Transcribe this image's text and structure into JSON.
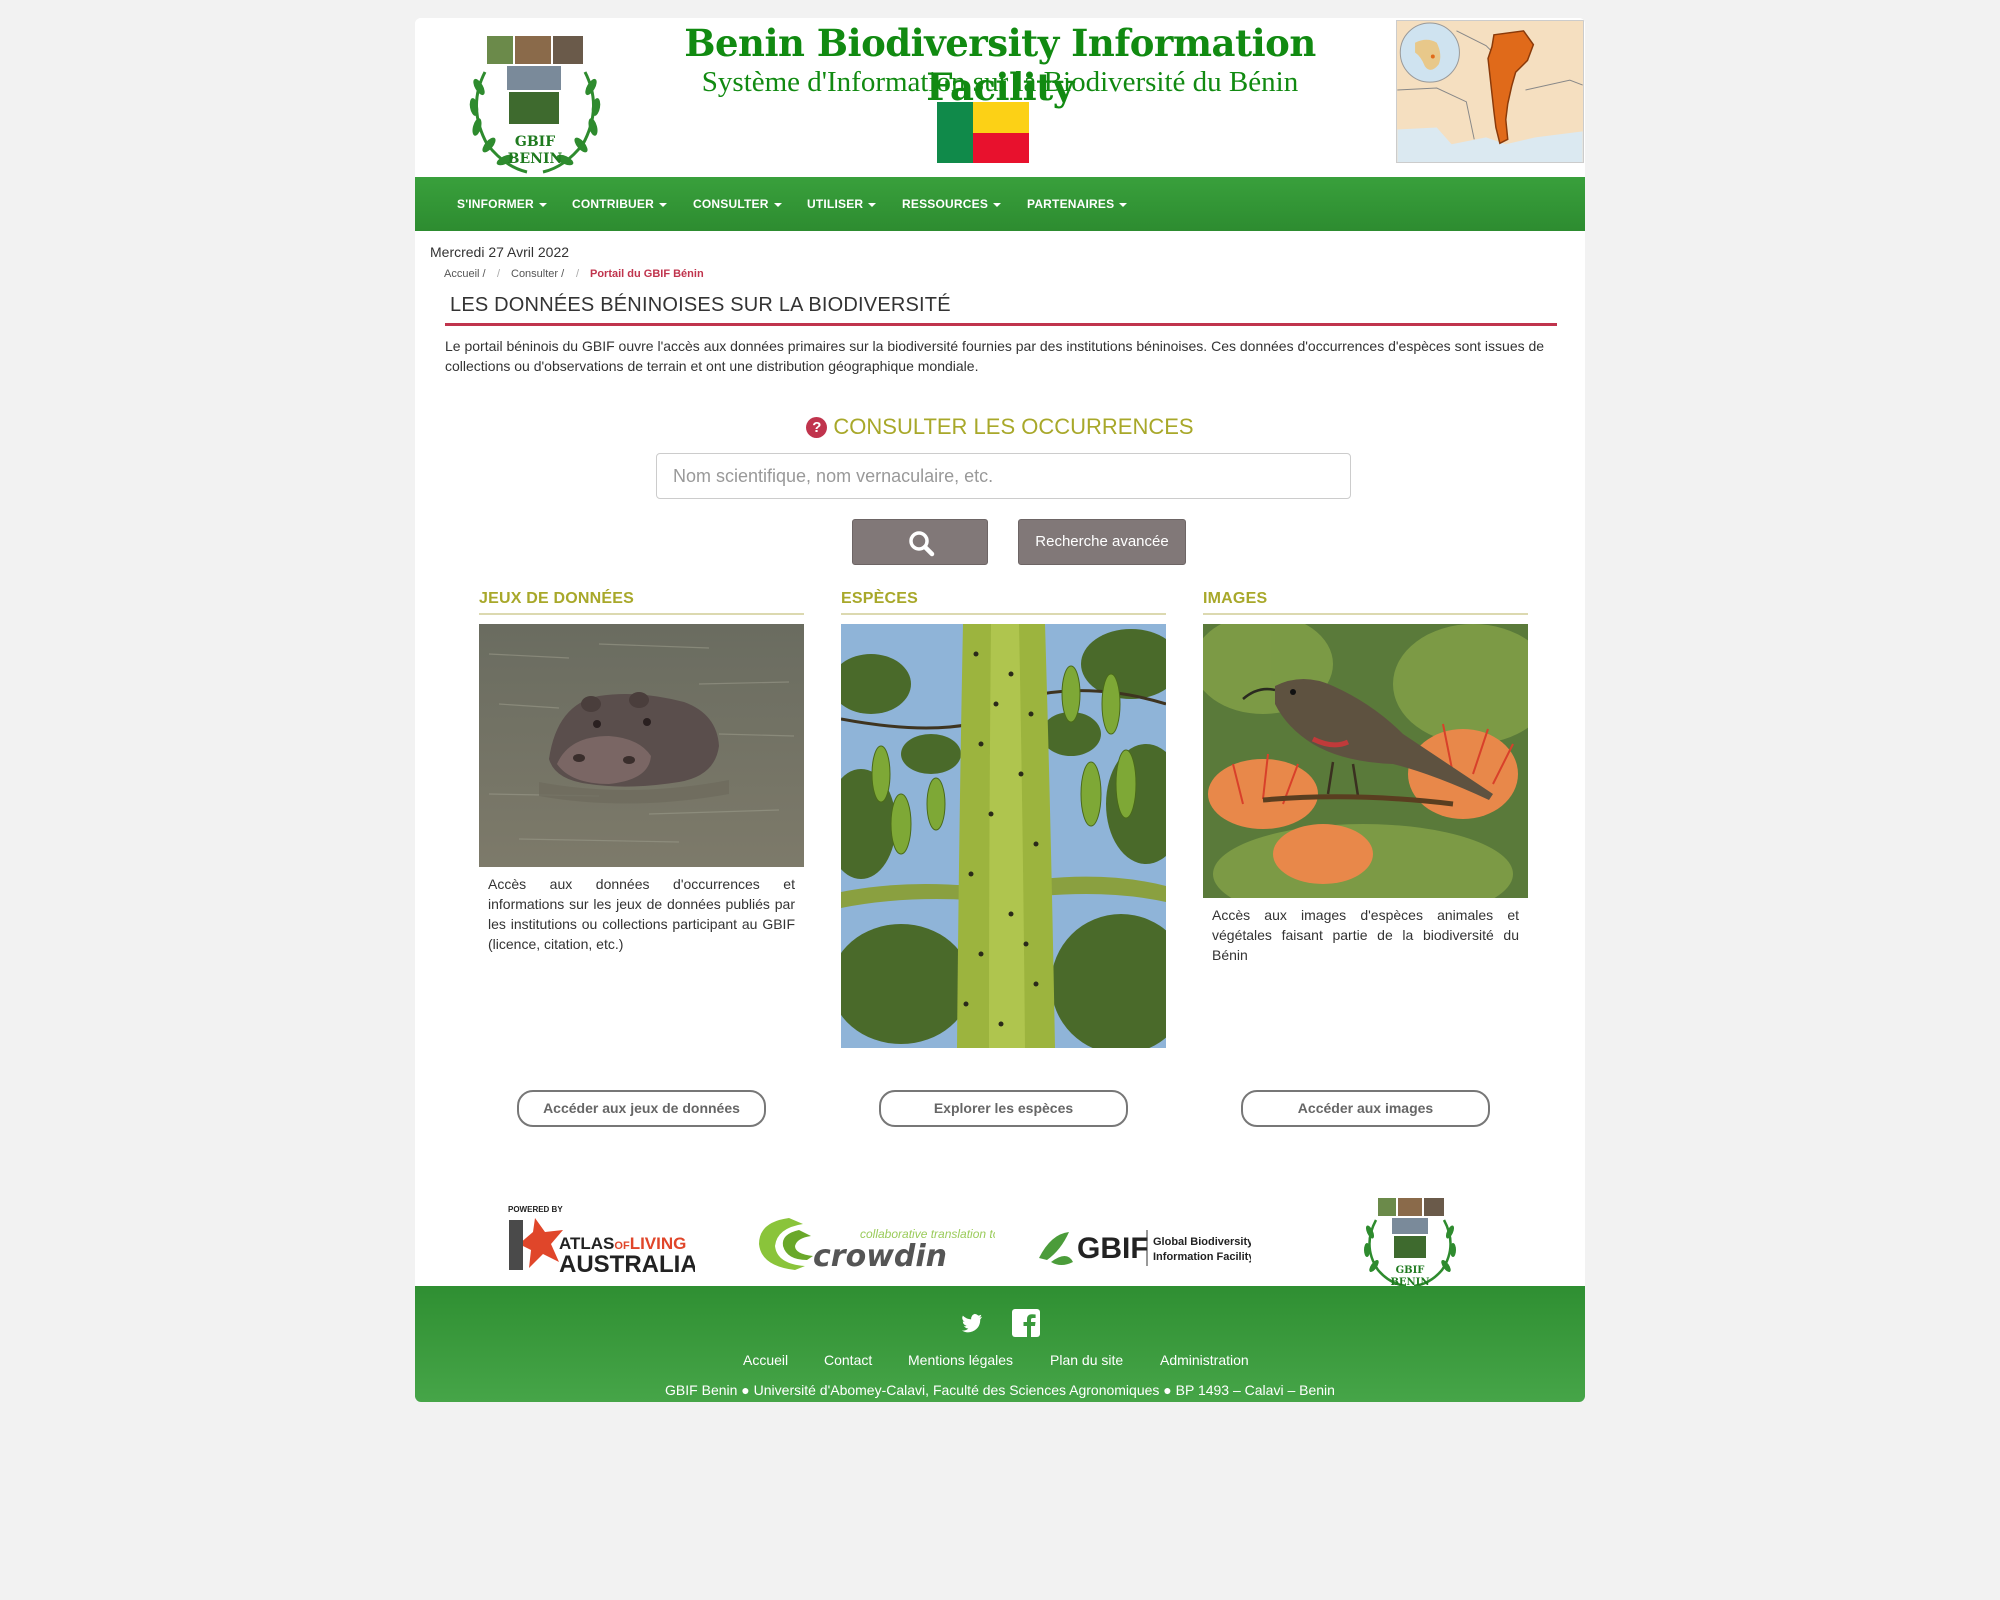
{
  "header": {
    "title": "Benin Biodiversity Information Facility",
    "subtitle": "Système d'Information sur la Biodiversité du Bénin",
    "logo_text_1": "GBIF",
    "logo_text_2": "BENIN"
  },
  "nav": {
    "items": [
      {
        "label": "S'INFORMER"
      },
      {
        "label": "CONTRIBUER"
      },
      {
        "label": "CONSULTER"
      },
      {
        "label": "UTILISER"
      },
      {
        "label": "RESSOURCES"
      },
      {
        "label": "PARTENAIRES"
      }
    ]
  },
  "date": "Mercredi 27 Avril 2022",
  "breadcrumb": {
    "items": [
      "Accueil /",
      "Consulter /",
      "Portail du GBIF Bénin"
    ],
    "separator": "/"
  },
  "section": {
    "title": "LES DONNÉES BÉNINOISES SUR LA BIODIVERSITÉ",
    "intro": "Le portail béninois du GBIF ouvre l'accès aux données primaires sur la biodiversité fournies par des institutions béninoises. Ces données d'occurrences d'espèces sont issues de collections ou d'observations de terrain et ont une distribution géographique mondiale."
  },
  "occurrences": {
    "heading": "CONSULTER LES OCCURRENCES",
    "help_icon": "?",
    "search_placeholder": "Nom scientifique, nom vernaculaire, etc.",
    "search_icon": "magnifier-icon",
    "advanced_label": "Recherche avancée"
  },
  "columns": [
    {
      "heading": "JEUX DE DONNÉES",
      "image": "hippopotamus-in-water",
      "text": "Accès aux données d'occurrences et informations sur les jeux de données publiés par les institutions ou collections participant au GBIF (licence, citation, etc.)",
      "button": "Accéder aux jeux de données"
    },
    {
      "heading": "ESPÈCES",
      "image": "spiny-tree-trunk-with-fruits",
      "text": "",
      "button": "Explorer les espèces"
    },
    {
      "heading": "IMAGES",
      "image": "sunbird-on-flowers",
      "text": "Accès aux images d'espèces animales et végétales faisant partie de la biodiversité du Bénin",
      "button": "Accéder aux images"
    }
  ],
  "partners": {
    "ala_powered": "POWERED BY",
    "ala_line1_a": "ATLAS",
    "ala_line1_b": "OF",
    "ala_line1_c": "LIVING",
    "ala_line2": "AUSTRALIA",
    "crowdin_tag": "collaborative translation tool",
    "crowdin_name": "crowdin",
    "gbif_name": "GBIF",
    "gbif_full_1": "Global Biodiversity",
    "gbif_full_2": "Information Facility",
    "benin_logo_1": "GBIF",
    "benin_logo_2": "BENIN"
  },
  "footer": {
    "social": [
      "twitter-icon",
      "facebook-icon"
    ],
    "links": [
      "Accueil",
      "Contact",
      "Mentions légales",
      "Plan du site",
      "Administration"
    ],
    "address": "GBIF Benin ● Université d'Abomey-Calavi, Faculté des Sciences Agronomiques ● BP 1493 – Calavi – Benin"
  },
  "colors": {
    "brand_green": "#2d8c30",
    "title_green": "#118a11",
    "accent_red": "#c0344d",
    "olive": "#a8a82a",
    "button_grey": "#817878"
  }
}
